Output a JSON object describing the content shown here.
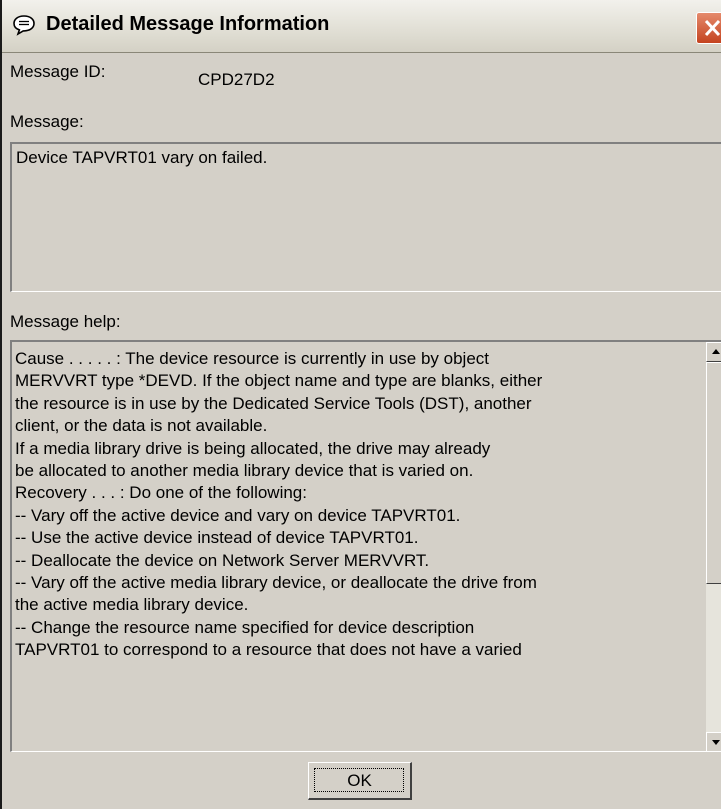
{
  "window": {
    "title": "Detailed Message Information",
    "icons": {
      "title": "speech-bubble-icon",
      "close": "close-x-icon"
    },
    "accent_close": "#c4431f"
  },
  "fields": {
    "message_id_label": "Message ID:",
    "message_id_value": "CPD27D2",
    "message_label": "Message:",
    "message_text": "Device TAPVRT01 vary on failed.",
    "help_label": "Message help:"
  },
  "help_lines": [
    "Cause . . . . . :   The device resource is currently in use by object",
    "MERVVRT type *DEVD. If the object name and type are blanks, either",
    "the resource is in use by the Dedicated Service Tools (DST), another",
    "client, or the data is not available.",
    "      If a media library drive is being allocated, the drive may already",
    "be allocated to another media library device that is varied on.",
    " Recovery  . . . :   Do one of the following:",
    "-- Vary off the active device and vary on device TAPVRT01.",
    "-- Use the active device instead of device TAPVRT01.",
    "-- Deallocate the device on Network Server MERVVRT.",
    " -- Vary off the active media library device, or deallocate the drive from",
    "the active media library device.",
    " -- Change the resource name specified for device description",
    "TAPVRT01 to correspond to a resource that does not have a varied"
  ],
  "buttons": {
    "ok": "OK"
  }
}
